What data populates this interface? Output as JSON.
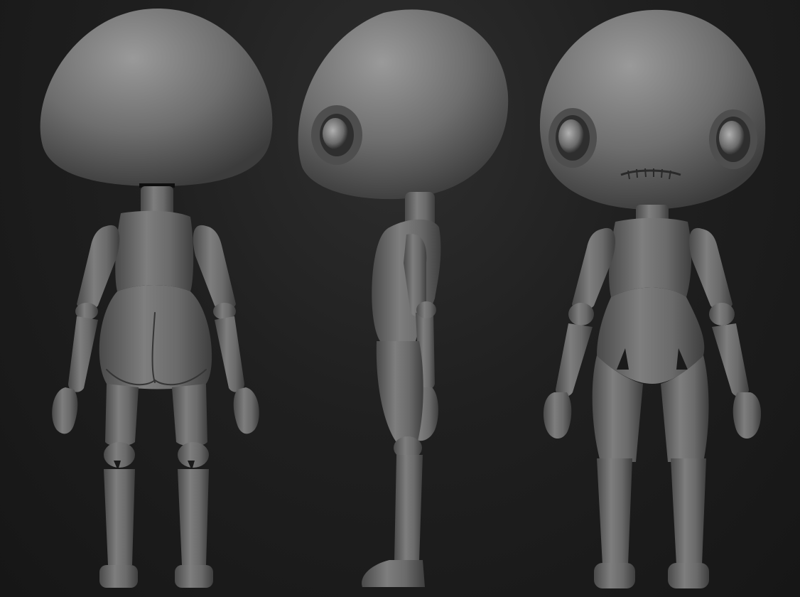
{
  "scene": {
    "views": [
      {
        "label": "back-view"
      },
      {
        "label": "side-view"
      },
      {
        "label": "front-view"
      }
    ],
    "colors": {
      "background_top": "#2e2e2e",
      "background_bottom": "#161616",
      "model_light": "#9a9a9a",
      "model_mid": "#6e6e6e",
      "model_dark": "#3c3c3c"
    }
  }
}
